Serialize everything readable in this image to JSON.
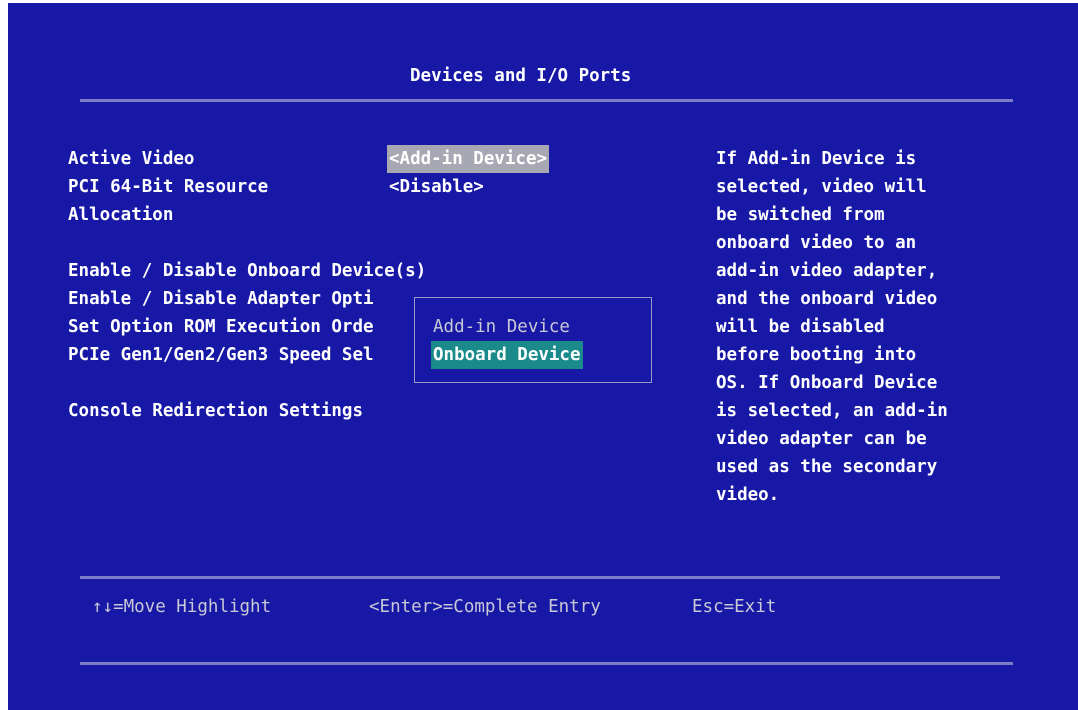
{
  "header": {
    "title": "Devices and I/O Ports"
  },
  "settings": {
    "active_video_label": "Active Video",
    "active_video_value": "<Add-in Device>",
    "pci_resource_label_line1": "PCI 64-Bit Resource",
    "pci_resource_label_line2": "Allocation",
    "pci_resource_value": "<Disable>",
    "onboard_devices_label": "Enable / Disable Onboard Device(s)",
    "adapter_option_label": "Enable / Disable Adapter Opti",
    "option_rom_label": "Set Option ROM Execution Orde",
    "pcie_speed_label": "PCIe Gen1/Gen2/Gen3 Speed Sel",
    "console_redirection_label": "Console Redirection Settings"
  },
  "popup": {
    "options": [
      "Add-in Device",
      "Onboard Device"
    ],
    "selected": "Onboard Device"
  },
  "help": {
    "lines": [
      "If Add-in Device is",
      "selected, video will",
      "be switched from",
      "onboard video to an",
      "add-in video adapter,",
      "and the onboard video",
      "will be disabled",
      "before booting into",
      "OS. If Onboard Device",
      "is selected, an add-in",
      "video adapter can be",
      "used as the secondary",
      "video."
    ]
  },
  "footer": {
    "move_hint": "↑↓=Move Highlight",
    "enter_hint": "<Enter>=Complete Entry",
    "esc_hint": "Esc=Exit"
  },
  "colors": {
    "background": "#1818a6",
    "text": "#ffffff",
    "highlight_value": "#a8a8b4",
    "popup_selection": "#1a8a8a",
    "rule": "#7c7cc8"
  }
}
